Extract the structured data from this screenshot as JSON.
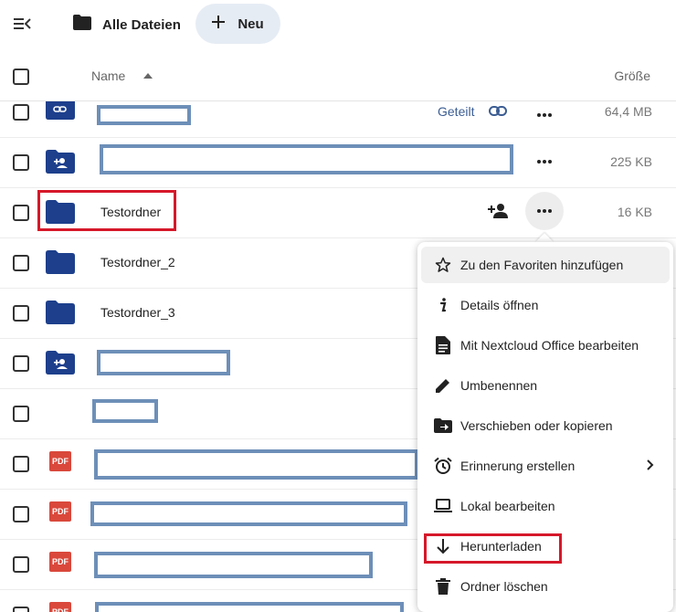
{
  "topbar": {
    "breadcrumb_label": "Alle Dateien",
    "new_label": "Neu"
  },
  "table": {
    "col_name": "Name",
    "col_size": "Größe"
  },
  "rows": [
    {
      "name": "",
      "icon": "shared-link-folder-icon",
      "shared_label": "Geteilt",
      "size": "64,4 MB"
    },
    {
      "name": "",
      "icon": "shared-user-folder-icon",
      "size": "225 KB"
    },
    {
      "name": "Testordner",
      "icon": "folder-icon",
      "size": "16 KB"
    },
    {
      "name": "Testordner_2",
      "icon": "folder-icon"
    },
    {
      "name": "Testordner_3",
      "icon": "folder-icon"
    },
    {
      "name": "",
      "icon": "shared-user-folder-icon"
    },
    {
      "name": "",
      "icon": ""
    },
    {
      "name": "",
      "icon": "pdf-icon",
      "badge": "PDF"
    },
    {
      "name": "",
      "icon": "pdf-icon",
      "badge": "PDF"
    },
    {
      "name": "",
      "icon": "pdf-icon",
      "badge": "PDF"
    },
    {
      "name": "",
      "icon": "pdf-icon",
      "badge": "PDF"
    }
  ],
  "context_menu": {
    "items": [
      {
        "label": "Zu den Favoriten hinzufügen",
        "icon": "star-icon"
      },
      {
        "label": "Details öffnen",
        "icon": "info-icon"
      },
      {
        "label": "Mit Nextcloud Office bearbeiten",
        "icon": "document-icon"
      },
      {
        "label": "Umbenennen",
        "icon": "pencil-icon"
      },
      {
        "label": "Verschieben oder kopieren",
        "icon": "folder-move-icon"
      },
      {
        "label": "Erinnerung erstellen",
        "icon": "alarm-icon"
      },
      {
        "label": "Lokal bearbeiten",
        "icon": "laptop-icon"
      },
      {
        "label": "Herunterladen",
        "icon": "download-icon"
      },
      {
        "label": "Ordner löschen",
        "icon": "trash-icon"
      }
    ]
  },
  "colors": {
    "folder": "#1d3f8c",
    "redaction": "#6d8fb8",
    "highlight": "#d6182a",
    "pdf": "#d9483b",
    "shared_link": "#3b5d93"
  }
}
